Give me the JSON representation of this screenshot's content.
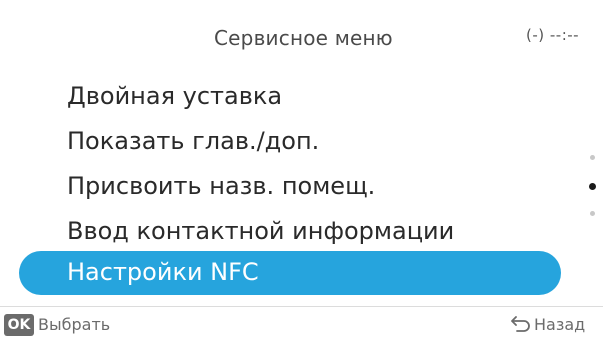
{
  "header": {
    "title": "Сервисное меню",
    "status": "(-) --:--"
  },
  "menu": {
    "items": [
      {
        "label": "Двойная уставка"
      },
      {
        "label": "Показать глав./доп."
      },
      {
        "label": "Присвоить назв. помещ."
      },
      {
        "label": "Ввод контактной информации"
      },
      {
        "label": "Настройки NFC",
        "selected": true
      }
    ]
  },
  "scroll_indicator": {
    "count": 3,
    "active_index": 1
  },
  "footer": {
    "ok_key": "OK",
    "select_label": "Выбрать",
    "back_icon": "return-arrow-icon",
    "back_label": "Назад"
  },
  "colors": {
    "selection": "#26a4dd",
    "text": "#2a2a2a",
    "muted": "#6b6b6b"
  }
}
